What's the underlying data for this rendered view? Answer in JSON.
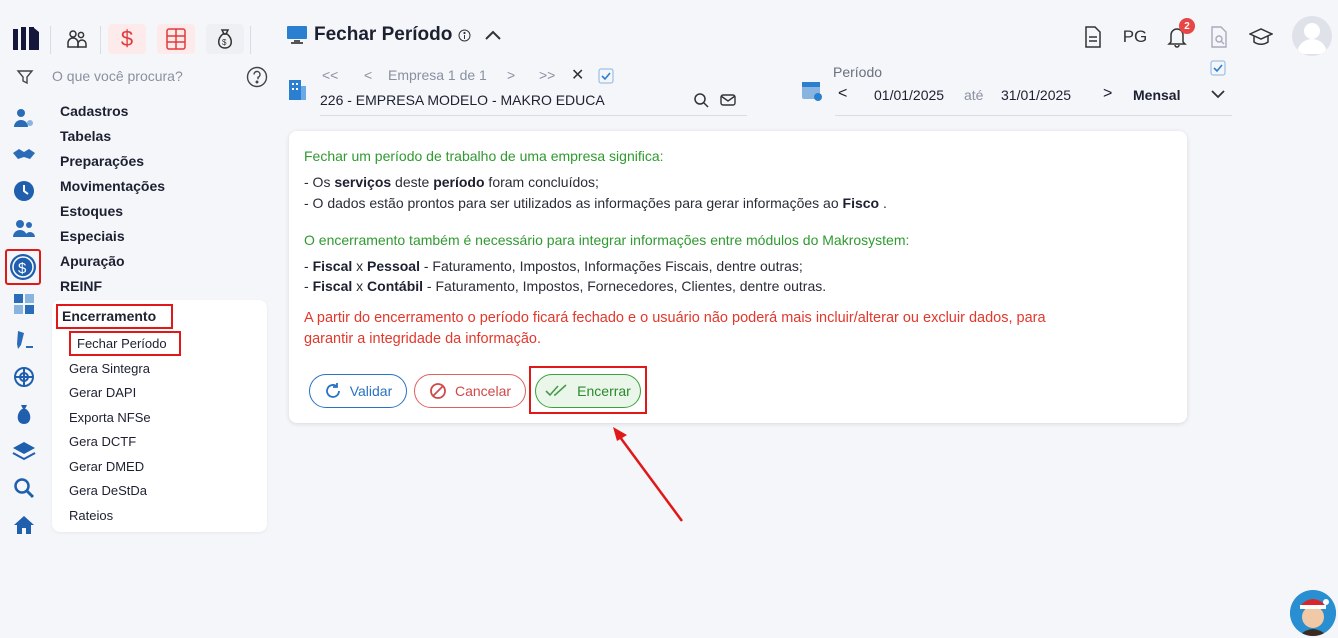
{
  "topbar": {
    "icons": [
      "logo-icon",
      "people-icon",
      "dollar-icon",
      "calculator-icon",
      "money-bag-icon"
    ]
  },
  "search": {
    "placeholder": "O que você procura?"
  },
  "menu": {
    "items": [
      "Cadastros",
      "Tabelas",
      "Preparações",
      "Movimentações",
      "Estoques",
      "Especiais",
      "Apuração",
      "REINF"
    ],
    "submenu_title": "Encerramento",
    "sub_items": [
      "Fechar Período",
      "Gera Sintegra",
      "Gerar DAPI",
      "Exporta NFSe",
      "Gera DCTF",
      "Gerar DMED",
      "Gera DeStDa",
      "Rateios"
    ]
  },
  "page": {
    "title": "Fechar Período"
  },
  "header": {
    "pg_label": "PG",
    "notification_count": "2"
  },
  "company_nav": {
    "label": "Empresa 1 de 1",
    "company": "226 - EMPRESA MODELO - MAKRO EDUCA"
  },
  "period": {
    "label": "Período",
    "start": "01/01/2025",
    "connector": "até",
    "end": "31/01/2025",
    "frequency": "Mensal"
  },
  "card": {
    "heading1": "Fechar um período de trabalho de uma empresa significa:",
    "line1_prefix": "- Os ",
    "line1_b1": "serviços",
    "line1_mid": " deste ",
    "line1_b2": "período",
    "line1_suffix": " foram concluídos;",
    "line2_prefix": "- O dados estão prontos para ser utilizados as informações para gerar informações ao ",
    "line2_b": "Fisco",
    "line2_suffix": " .",
    "heading2": "O encerramento também é necessário para integrar informações entre módulos do Makrosystem:",
    "line3_prefix": "- ",
    "line3_b1": "Fiscal",
    "line3_x": " x ",
    "line3_b2": "Pessoal",
    "line3_suffix": " - Faturamento, Impostos, Informações Fiscais, dentre outras;",
    "line4_prefix": "- ",
    "line4_b1": "Fiscal",
    "line4_x": " x ",
    "line4_b2": "Contábil",
    "line4_suffix": " - Faturamento, Impostos, Fornecedores, Clientes, dentre outras.",
    "warning1": "A partir do encerramento o período ficará fechado e o usuário não poderá mais incluir/alterar ou excluir dados, para",
    "warning2": "garantir a integridade da informação."
  },
  "buttons": {
    "validar": "Validar",
    "cancelar": "Cancelar",
    "encerrar": "Encerrar"
  },
  "colors": {
    "green": "#2f9a30",
    "red": "#e2382c",
    "blue": "#2a72c4",
    "highlight": "#e01818"
  }
}
